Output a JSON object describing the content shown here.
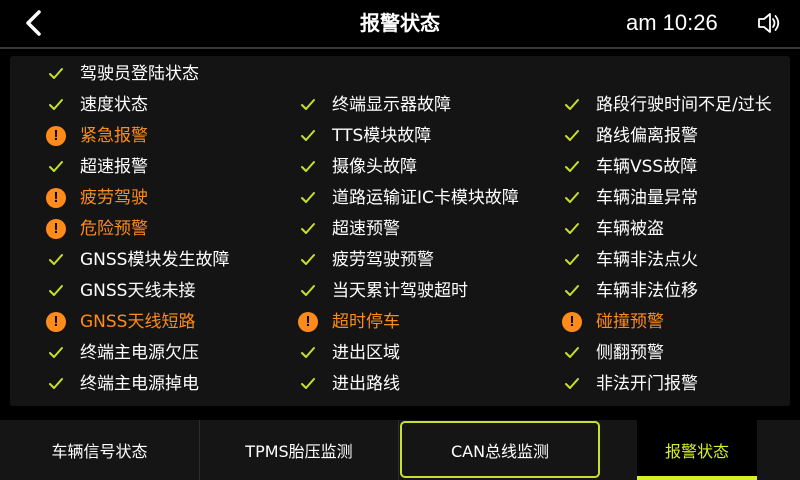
{
  "header": {
    "title": "报警状态",
    "time": "am 10:26"
  },
  "columns": [
    [
      {
        "label": "驾驶员登陆状态",
        "status": "ok"
      },
      {
        "label": "速度状态",
        "status": "ok"
      },
      {
        "label": "紧急报警",
        "status": "alarm"
      },
      {
        "label": "超速报警",
        "status": "ok"
      },
      {
        "label": "疲劳驾驶",
        "status": "alarm"
      },
      {
        "label": "危险预警",
        "status": "alarm"
      },
      {
        "label": "GNSS模块发生故障",
        "status": "ok"
      },
      {
        "label": "GNSS天线未接",
        "status": "ok"
      },
      {
        "label": "GNSS天线短路",
        "status": "alarm"
      },
      {
        "label": "终端主电源欠压",
        "status": "ok"
      },
      {
        "label": "终端主电源掉电",
        "status": "ok"
      }
    ],
    [
      {
        "label": "终端显示器故障",
        "status": "ok"
      },
      {
        "label": "TTS模块故障",
        "status": "ok"
      },
      {
        "label": "摄像头故障",
        "status": "ok"
      },
      {
        "label": "道路运输证IC卡模块故障",
        "status": "ok"
      },
      {
        "label": "超速预警",
        "status": "ok"
      },
      {
        "label": "疲劳驾驶预警",
        "status": "ok"
      },
      {
        "label": "当天累计驾驶超时",
        "status": "ok"
      },
      {
        "label": "超时停车",
        "status": "alarm"
      },
      {
        "label": "进出区域",
        "status": "ok"
      },
      {
        "label": "进出路线",
        "status": "ok"
      }
    ],
    [
      {
        "label": "路段行驶时间不足/过长",
        "status": "ok"
      },
      {
        "label": "路线偏离报警",
        "status": "ok"
      },
      {
        "label": "车辆VSS故障",
        "status": "ok"
      },
      {
        "label": "车辆油量异常",
        "status": "ok"
      },
      {
        "label": "车辆被盗",
        "status": "ok"
      },
      {
        "label": "车辆非法点火",
        "status": "ok"
      },
      {
        "label": "车辆非法位移",
        "status": "ok"
      },
      {
        "label": "碰撞预警",
        "status": "alarm"
      },
      {
        "label": "侧翻预警",
        "status": "ok"
      },
      {
        "label": "非法开门报警",
        "status": "ok"
      }
    ]
  ],
  "tabs": [
    {
      "label": "车辆信号状态",
      "name": "tab-vehicle-signal"
    },
    {
      "label": "TPMS胎压监测",
      "name": "tab-tpms"
    },
    {
      "label": "CAN总线监测",
      "name": "tab-can-bus"
    },
    {
      "label": "报警状态",
      "name": "tab-alarm-status"
    }
  ],
  "icons": {
    "back": "back-arrow-icon",
    "volume": "speaker-icon",
    "ok": "check-icon",
    "alarm": "warning-icon"
  },
  "colors": {
    "ok": "#c8e028",
    "alarm": "#ff8c1a",
    "active_tab": "#d6ef2a",
    "background": "#000000",
    "panel": "#141414"
  }
}
